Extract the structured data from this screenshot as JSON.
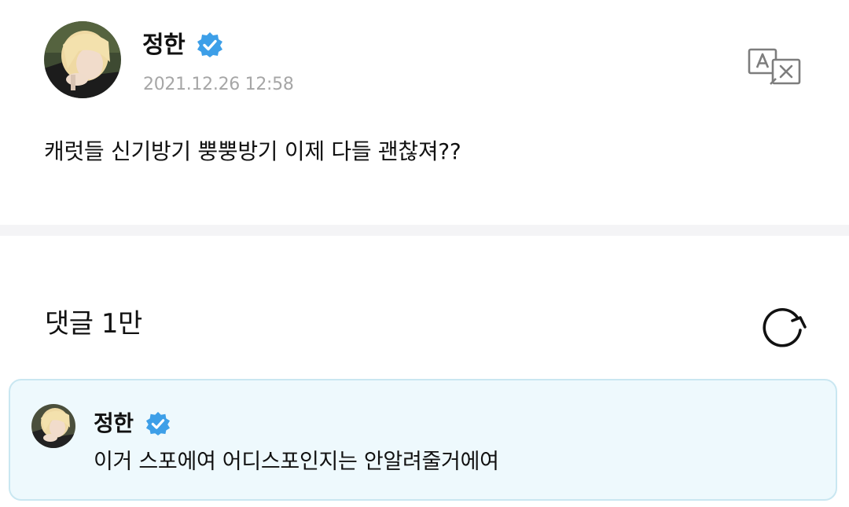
{
  "post": {
    "author": "정한",
    "timestamp": "2021.12.26 12:58",
    "text": "캐럿들 신기방기 뿡뿡방기 이제 다들 괜찮져??"
  },
  "comments": {
    "title": "댓글 1만",
    "pinned": {
      "author": "정한",
      "text": "이거 스포에여 어디스포인지는 안알려줄거에여"
    }
  },
  "colors": {
    "verified_badge": "#3d9fe8",
    "timestamp": "#a6a6a6",
    "pinned_bg": "#eef9fd",
    "pinned_border": "#c9e7f1",
    "divider": "#f4f4f6"
  },
  "icons": {
    "verified": "verified-badge-icon",
    "translate": "translate-icon",
    "refresh": "refresh-icon"
  }
}
